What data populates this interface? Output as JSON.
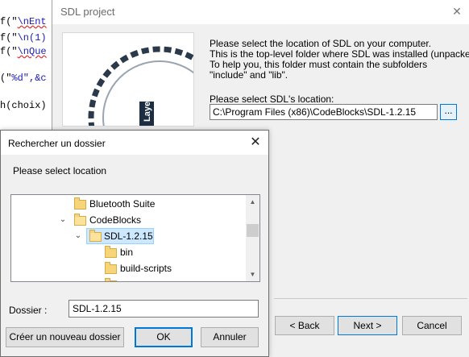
{
  "editor": {
    "lines": [
      {
        "pre": "f(\"",
        "str": "\\nEnt"
      },
      {
        "pre": "f(\"",
        "str": "\\n(1)"
      },
      {
        "pre": "f(\"",
        "str": "\\nQue"
      },
      {
        "pre": "(\"",
        "str": "%d\",&c"
      },
      {
        "pre": "h(choix)",
        "str": ""
      }
    ]
  },
  "wizard": {
    "title": "SDL project",
    "close_glyph": "✕",
    "instructions": [
      "Please select the location of SDL on your computer.",
      "This is the top-level folder where SDL was installed (unpacked).",
      "To help you, this folder must contain the subfolders",
      "\"include\" and \"lib\"."
    ],
    "location_label": "Please select SDL's location:",
    "location_value": "C:\\Program Files (x86)\\CodeBlocks\\SDL-1.2.15",
    "browse_label": "...",
    "back_label": "< Back",
    "next_label": "Next >",
    "cancel_label": "Cancel",
    "logo_text": "Layer"
  },
  "dialog": {
    "title": "Rechercher un dossier",
    "close_glyph": "✕",
    "prompt": "Please select location",
    "tree": [
      {
        "label": "Bluetooth Suite",
        "expander": "",
        "selected": false
      },
      {
        "label": "CodeBlocks",
        "expander": "⌄",
        "selected": false
      },
      {
        "label": "SDL-1.2.15",
        "expander": "⌄",
        "selected": true
      },
      {
        "label": "bin",
        "expander": "",
        "selected": false
      },
      {
        "label": "build-scripts",
        "expander": "",
        "selected": false
      }
    ],
    "folder_label": "Dossier :",
    "folder_value": "SDL-1.2.15",
    "new_folder_label": "Créer un nouveau dossier",
    "ok_label": "OK",
    "cancel_label": "Annuler",
    "scroll_up": "▲",
    "scroll_down": "▼"
  }
}
